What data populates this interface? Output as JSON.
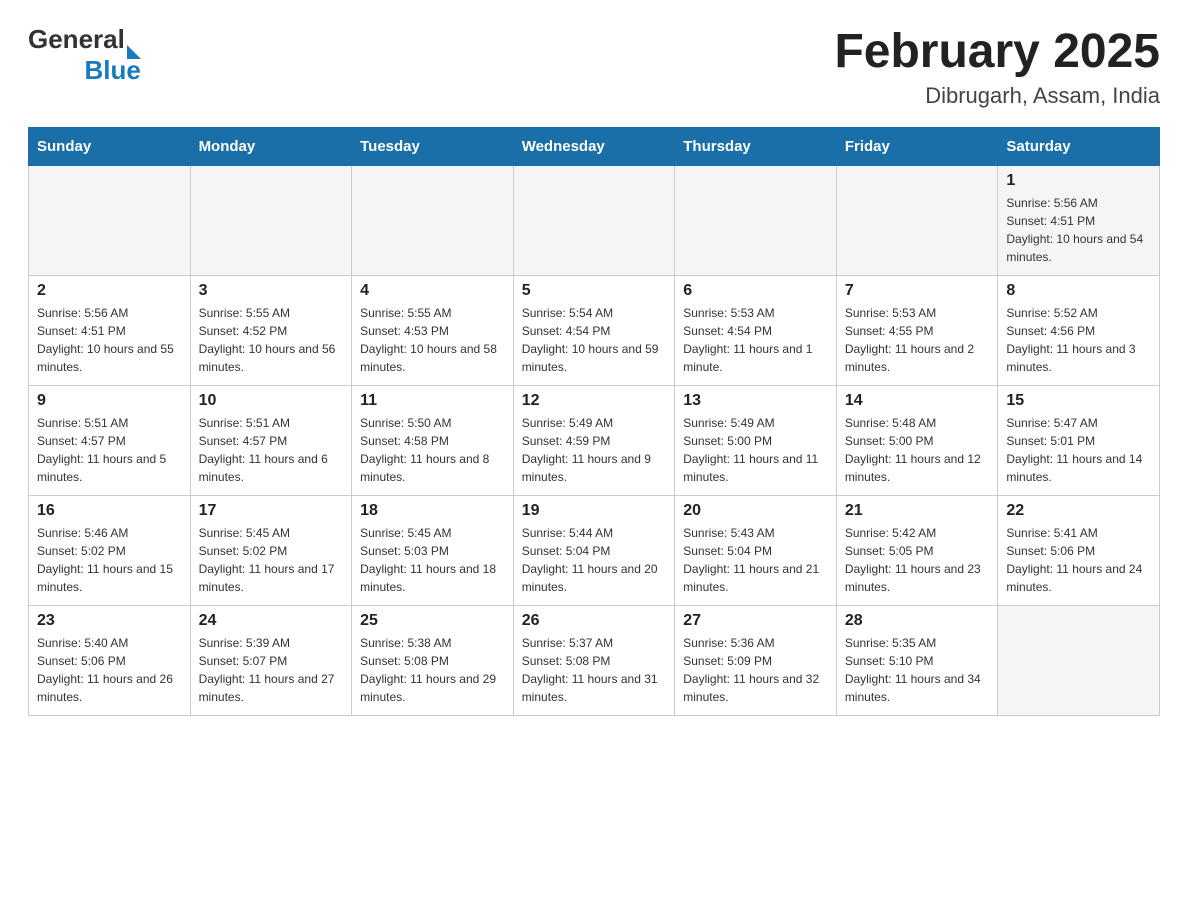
{
  "header": {
    "logo_general": "General",
    "logo_blue": "Blue",
    "month_title": "February 2025",
    "location": "Dibrugarh, Assam, India"
  },
  "weekdays": [
    "Sunday",
    "Monday",
    "Tuesday",
    "Wednesday",
    "Thursday",
    "Friday",
    "Saturday"
  ],
  "weeks": [
    [
      {
        "day": "",
        "sunrise": "",
        "sunset": "",
        "daylight": ""
      },
      {
        "day": "",
        "sunrise": "",
        "sunset": "",
        "daylight": ""
      },
      {
        "day": "",
        "sunrise": "",
        "sunset": "",
        "daylight": ""
      },
      {
        "day": "",
        "sunrise": "",
        "sunset": "",
        "daylight": ""
      },
      {
        "day": "",
        "sunrise": "",
        "sunset": "",
        "daylight": ""
      },
      {
        "day": "",
        "sunrise": "",
        "sunset": "",
        "daylight": ""
      },
      {
        "day": "1",
        "sunrise": "Sunrise: 5:56 AM",
        "sunset": "Sunset: 4:51 PM",
        "daylight": "Daylight: 10 hours and 54 minutes."
      }
    ],
    [
      {
        "day": "2",
        "sunrise": "Sunrise: 5:56 AM",
        "sunset": "Sunset: 4:51 PM",
        "daylight": "Daylight: 10 hours and 55 minutes."
      },
      {
        "day": "3",
        "sunrise": "Sunrise: 5:55 AM",
        "sunset": "Sunset: 4:52 PM",
        "daylight": "Daylight: 10 hours and 56 minutes."
      },
      {
        "day": "4",
        "sunrise": "Sunrise: 5:55 AM",
        "sunset": "Sunset: 4:53 PM",
        "daylight": "Daylight: 10 hours and 58 minutes."
      },
      {
        "day": "5",
        "sunrise": "Sunrise: 5:54 AM",
        "sunset": "Sunset: 4:54 PM",
        "daylight": "Daylight: 10 hours and 59 minutes."
      },
      {
        "day": "6",
        "sunrise": "Sunrise: 5:53 AM",
        "sunset": "Sunset: 4:54 PM",
        "daylight": "Daylight: 11 hours and 1 minute."
      },
      {
        "day": "7",
        "sunrise": "Sunrise: 5:53 AM",
        "sunset": "Sunset: 4:55 PM",
        "daylight": "Daylight: 11 hours and 2 minutes."
      },
      {
        "day": "8",
        "sunrise": "Sunrise: 5:52 AM",
        "sunset": "Sunset: 4:56 PM",
        "daylight": "Daylight: 11 hours and 3 minutes."
      }
    ],
    [
      {
        "day": "9",
        "sunrise": "Sunrise: 5:51 AM",
        "sunset": "Sunset: 4:57 PM",
        "daylight": "Daylight: 11 hours and 5 minutes."
      },
      {
        "day": "10",
        "sunrise": "Sunrise: 5:51 AM",
        "sunset": "Sunset: 4:57 PM",
        "daylight": "Daylight: 11 hours and 6 minutes."
      },
      {
        "day": "11",
        "sunrise": "Sunrise: 5:50 AM",
        "sunset": "Sunset: 4:58 PM",
        "daylight": "Daylight: 11 hours and 8 minutes."
      },
      {
        "day": "12",
        "sunrise": "Sunrise: 5:49 AM",
        "sunset": "Sunset: 4:59 PM",
        "daylight": "Daylight: 11 hours and 9 minutes."
      },
      {
        "day": "13",
        "sunrise": "Sunrise: 5:49 AM",
        "sunset": "Sunset: 5:00 PM",
        "daylight": "Daylight: 11 hours and 11 minutes."
      },
      {
        "day": "14",
        "sunrise": "Sunrise: 5:48 AM",
        "sunset": "Sunset: 5:00 PM",
        "daylight": "Daylight: 11 hours and 12 minutes."
      },
      {
        "day": "15",
        "sunrise": "Sunrise: 5:47 AM",
        "sunset": "Sunset: 5:01 PM",
        "daylight": "Daylight: 11 hours and 14 minutes."
      }
    ],
    [
      {
        "day": "16",
        "sunrise": "Sunrise: 5:46 AM",
        "sunset": "Sunset: 5:02 PM",
        "daylight": "Daylight: 11 hours and 15 minutes."
      },
      {
        "day": "17",
        "sunrise": "Sunrise: 5:45 AM",
        "sunset": "Sunset: 5:02 PM",
        "daylight": "Daylight: 11 hours and 17 minutes."
      },
      {
        "day": "18",
        "sunrise": "Sunrise: 5:45 AM",
        "sunset": "Sunset: 5:03 PM",
        "daylight": "Daylight: 11 hours and 18 minutes."
      },
      {
        "day": "19",
        "sunrise": "Sunrise: 5:44 AM",
        "sunset": "Sunset: 5:04 PM",
        "daylight": "Daylight: 11 hours and 20 minutes."
      },
      {
        "day": "20",
        "sunrise": "Sunrise: 5:43 AM",
        "sunset": "Sunset: 5:04 PM",
        "daylight": "Daylight: 11 hours and 21 minutes."
      },
      {
        "day": "21",
        "sunrise": "Sunrise: 5:42 AM",
        "sunset": "Sunset: 5:05 PM",
        "daylight": "Daylight: 11 hours and 23 minutes."
      },
      {
        "day": "22",
        "sunrise": "Sunrise: 5:41 AM",
        "sunset": "Sunset: 5:06 PM",
        "daylight": "Daylight: 11 hours and 24 minutes."
      }
    ],
    [
      {
        "day": "23",
        "sunrise": "Sunrise: 5:40 AM",
        "sunset": "Sunset: 5:06 PM",
        "daylight": "Daylight: 11 hours and 26 minutes."
      },
      {
        "day": "24",
        "sunrise": "Sunrise: 5:39 AM",
        "sunset": "Sunset: 5:07 PM",
        "daylight": "Daylight: 11 hours and 27 minutes."
      },
      {
        "day": "25",
        "sunrise": "Sunrise: 5:38 AM",
        "sunset": "Sunset: 5:08 PM",
        "daylight": "Daylight: 11 hours and 29 minutes."
      },
      {
        "day": "26",
        "sunrise": "Sunrise: 5:37 AM",
        "sunset": "Sunset: 5:08 PM",
        "daylight": "Daylight: 11 hours and 31 minutes."
      },
      {
        "day": "27",
        "sunrise": "Sunrise: 5:36 AM",
        "sunset": "Sunset: 5:09 PM",
        "daylight": "Daylight: 11 hours and 32 minutes."
      },
      {
        "day": "28",
        "sunrise": "Sunrise: 5:35 AM",
        "sunset": "Sunset: 5:10 PM",
        "daylight": "Daylight: 11 hours and 34 minutes."
      },
      {
        "day": "",
        "sunrise": "",
        "sunset": "",
        "daylight": ""
      }
    ]
  ]
}
